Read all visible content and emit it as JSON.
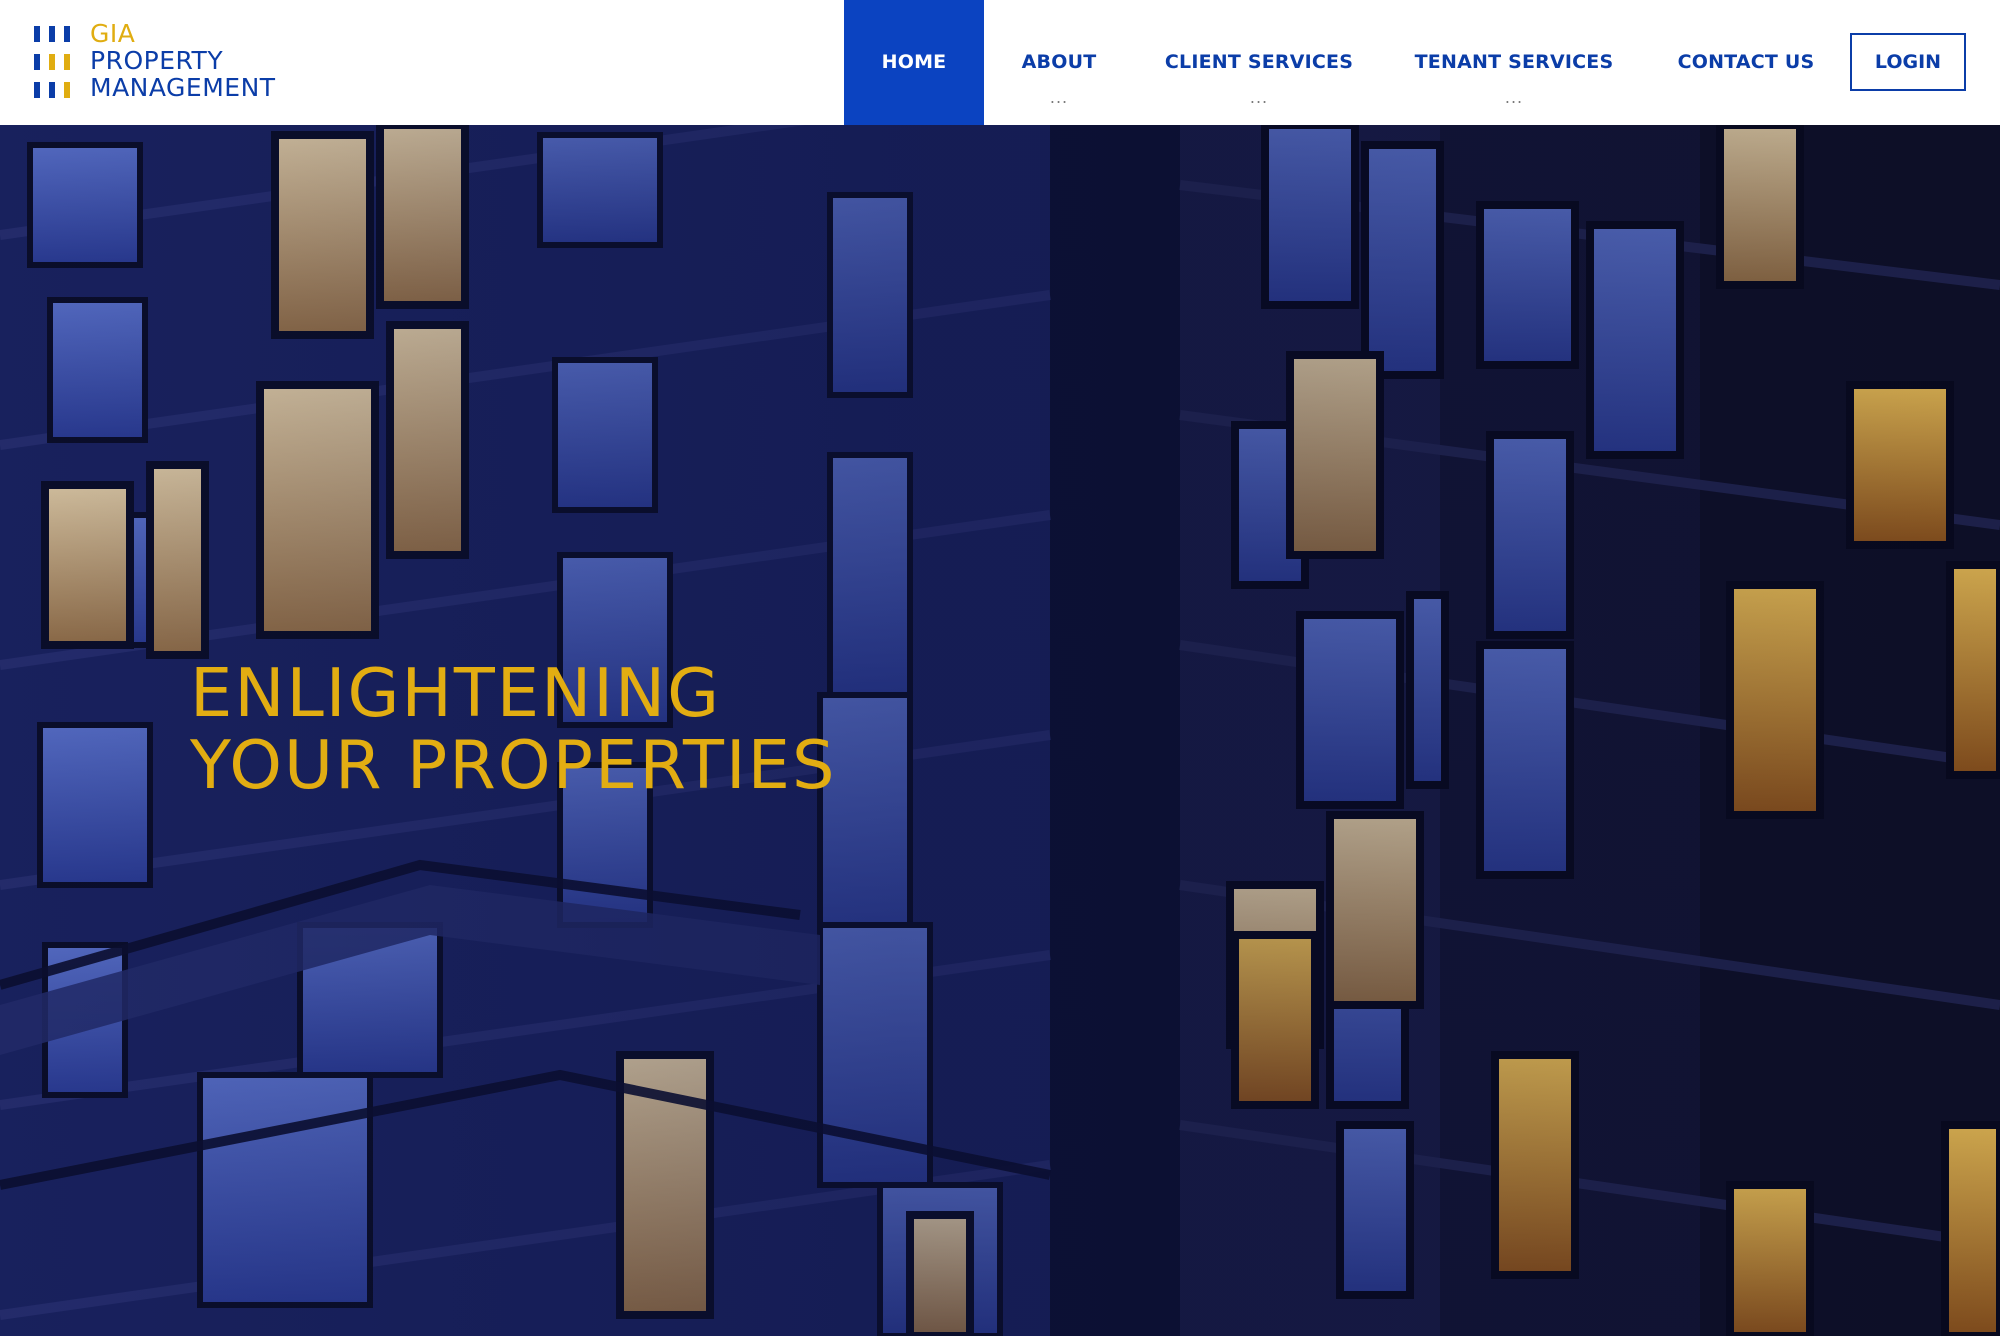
{
  "brand": {
    "line1": "GIA",
    "line2": "PROPERTY",
    "line3": "MANAGEMENT",
    "logo_icon": "bars-logo-icon",
    "colors": {
      "primary": "#0b3da8",
      "accent": "#e0ad11",
      "active_nav_bg": "#0b43c1"
    }
  },
  "nav": {
    "home": {
      "label": "HOME",
      "active": true
    },
    "about": {
      "label": "ABOUT",
      "more": "..."
    },
    "client_services": {
      "label": "CLIENT SERVICES",
      "more": "..."
    },
    "tenant_services": {
      "label": "TENANT SERVICES",
      "more": "..."
    },
    "contact": {
      "label": "CONTACT US"
    },
    "login": {
      "label": "LOGIN"
    }
  },
  "hero": {
    "headline_line1": "ENLIGHTENING",
    "headline_line2": "YOUR PROPERTIES",
    "headline_color": "#e2ad12",
    "background": "night-apartment-building-photo"
  }
}
